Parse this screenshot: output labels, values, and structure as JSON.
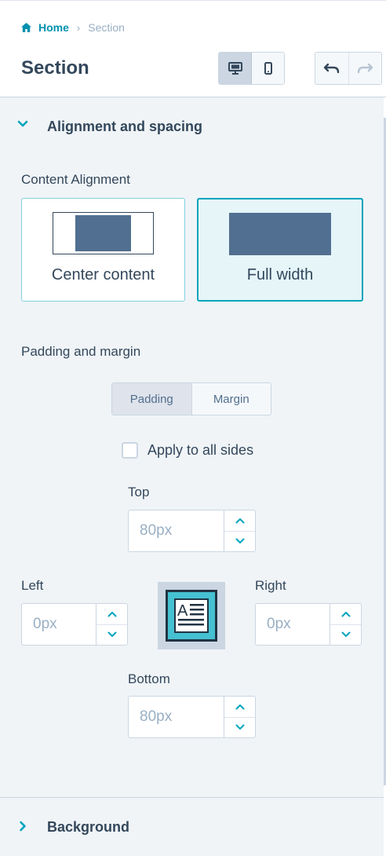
{
  "breadcrumb": {
    "home": "Home",
    "separator": "›",
    "current": "Section"
  },
  "page_title": "Section",
  "device_toggle": {
    "options": [
      "desktop-icon",
      "mobile-icon"
    ],
    "active": "desktop"
  },
  "history": {
    "undo_icon": "undo-icon",
    "redo_icon": "redo-icon",
    "redo_enabled": false
  },
  "alignment_section": {
    "title": "Alignment and spacing",
    "expanded": true,
    "content_alignment_label": "Content Alignment",
    "options": [
      {
        "label": "Center content",
        "selected": false
      },
      {
        "label": "Full width",
        "selected": true
      }
    ],
    "padding_margin_label": "Padding and margin",
    "tabs": [
      {
        "label": "Padding",
        "active": true
      },
      {
        "label": "Margin",
        "active": false
      }
    ],
    "apply_all_label": "Apply to all sides",
    "apply_all_checked": false,
    "fields": {
      "top": {
        "label": "Top",
        "placeholder": "80px"
      },
      "left": {
        "label": "Left",
        "placeholder": "0px"
      },
      "right": {
        "label": "Right",
        "placeholder": "0px"
      },
      "bottom": {
        "label": "Bottom",
        "placeholder": "80px"
      }
    }
  },
  "background_section": {
    "title": "Background",
    "expanded": false
  },
  "colors": {
    "accent": "#00a4bd",
    "link": "#0091ae",
    "text": "#33475b",
    "panel_bg": "#f0f4f7",
    "thumb_fill": "#516f90"
  }
}
